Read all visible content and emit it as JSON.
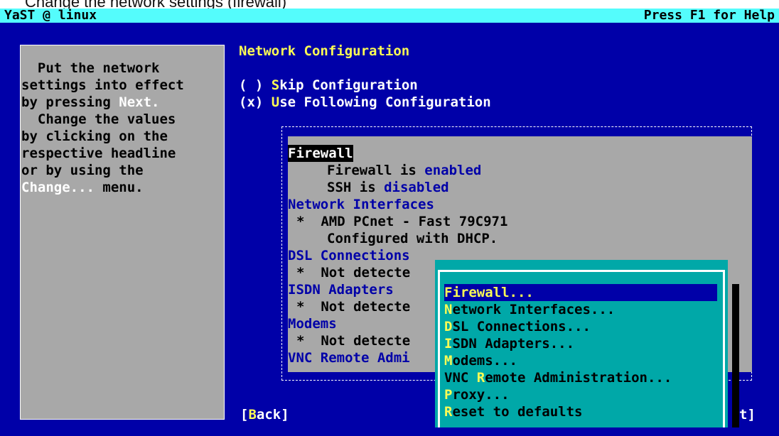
{
  "caption": "Change the network settings (firewall)",
  "topbar": {
    "title": "YaST @ linux",
    "help": "Press F1 for Help"
  },
  "help": {
    "lines": [
      "  Put the network",
      "settings into effect",
      "by pressing ",
      "  Change the values",
      "by clicking on the",
      "respective headline",
      "or by using the",
      " menu."
    ],
    "next_word": "Next.",
    "change_word": "Change..."
  },
  "main": {
    "title": "Network Configuration",
    "skip": {
      "marker": "( )",
      "hotkey": "S",
      "label": "kip Configuration"
    },
    "use": {
      "marker": "(x)",
      "hotkey": "U",
      "label": "se Following Configuration"
    }
  },
  "summary": {
    "firewall_header": "Firewall",
    "firewall_line1_prefix": "Firewall is ",
    "firewall_line1_value": "enabled",
    "firewall_line2_prefix": "SSH is ",
    "firewall_line2_value": "disabled",
    "netif_header": "Network Interfaces",
    "netif_item": "*  AMD PCnet - Fast 79C971",
    "netif_sub": "Configured with DHCP.",
    "dsl_header": "DSL Connections",
    "dsl_item": "*  Not detecte",
    "isdn_header": "ISDN Adapters",
    "isdn_item": "*  Not detecte",
    "modems_header": "Modems",
    "modems_item": "*  Not detecte",
    "vnc_header": "VNC Remote Admi"
  },
  "popup": {
    "items": [
      {
        "hotkey": "F",
        "rest": "irewall...",
        "selected": true
      },
      {
        "hotkey": "N",
        "rest": "etwork Interfaces...",
        "selected": false
      },
      {
        "hotkey": "D",
        "rest": "SL Connections...",
        "selected": false
      },
      {
        "hotkey": "I",
        "rest": "SDN Adapters...",
        "selected": false
      },
      {
        "hotkey": "M",
        "rest": "odems...",
        "selected": false
      },
      {
        "prefix": "VNC ",
        "hotkey": "R",
        "rest": "emote Administration...",
        "selected": false
      },
      {
        "hotkey": "P",
        "rest": "roxy...",
        "selected": false
      },
      {
        "hotkey": "R",
        "rest": "eset to defaults",
        "selected": false
      }
    ]
  },
  "buttons": {
    "back_open": "[",
    "back_hotkey": "B",
    "back_rest": "ack]",
    "next_partial": "t]"
  },
  "colors": {
    "background": "#0000a8",
    "panel": "#a8a8a8",
    "accent": "#fcfc54",
    "topbar": "#54fcfc",
    "popup": "#00a8a8"
  }
}
